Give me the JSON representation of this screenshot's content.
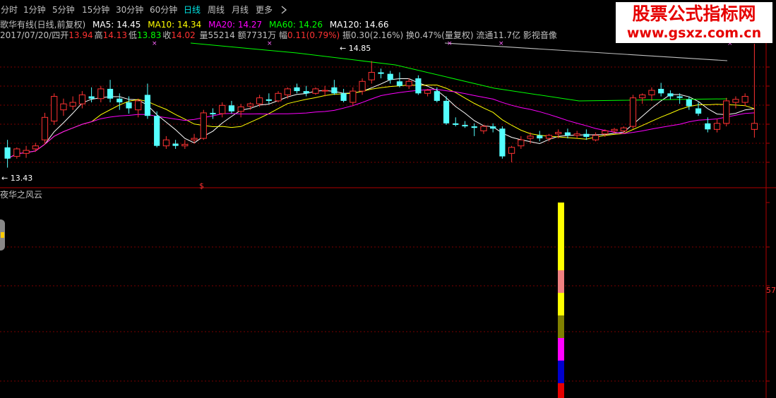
{
  "toolbar": {
    "tabs": [
      {
        "label": "分时",
        "active": false
      },
      {
        "label": "1分钟",
        "active": false
      },
      {
        "label": "5分钟",
        "active": false
      },
      {
        "label": "15分钟",
        "active": false
      },
      {
        "label": "30分钟",
        "active": false
      },
      {
        "label": "60分钟",
        "active": false
      },
      {
        "label": "日线",
        "active": true
      },
      {
        "label": "周线",
        "active": false
      },
      {
        "label": "月线",
        "active": false
      },
      {
        "label": "更多",
        "active": false
      }
    ],
    "more_icon": "chevron-right-icon"
  },
  "info_line1": {
    "stock_name": "歌华有线(日线,前复权)",
    "ma5": "MA5: 14.45",
    "ma10": "MA10: 14.34",
    "ma20": "MA20: 14.27",
    "ma60": "MA60: 14.26",
    "ma120": "MA120: 14.66"
  },
  "info_line2": {
    "date": "2017/07/20/四",
    "open_label": "开",
    "open": "13.94",
    "high_label": "高",
    "high": "14.13",
    "low_label": "低",
    "low": "13.83",
    "close_label": "收",
    "close": "14.02",
    "volume": "量55214",
    "amount": "额7731万",
    "change_label": "幅",
    "change": "0.11(0.79%)",
    "amplitude": "振0.30(2.16%)",
    "turnover": "换0.47%(量复权)",
    "float_shares": "流通11.7亿",
    "sector": "影视音像"
  },
  "price_annotations": {
    "high_label": "14.85",
    "low_label": "13.43",
    "dividend_mark": "$"
  },
  "watermark": {
    "title": "股票公式指标网",
    "url": "www.gsxz.com.cn"
  },
  "lower_panel": {
    "title": "夜华之风云",
    "right_scale_value": "57"
  },
  "colors": {
    "background": "#000000",
    "up_candle": "#ff3232",
    "down_candle": "#54ffff",
    "ma5": "#ffffff",
    "ma10": "#ffff00",
    "ma20": "#ff00ff",
    "ma60": "#00ff00",
    "ma120": "#ffffff",
    "grid": "#7a0000",
    "accent_tab": "#00e5e5",
    "watermark_red": "#e60000"
  },
  "chart_data": {
    "type": "candlestick",
    "ylim": [
      13.2,
      15.1
    ],
    "candles": [
      [
        13.7,
        13.8,
        13.43,
        13.55
      ],
      [
        13.58,
        13.7,
        13.55,
        13.68
      ],
      [
        13.62,
        13.72,
        13.56,
        13.66
      ],
      [
        13.68,
        13.76,
        13.64,
        13.72
      ],
      [
        13.8,
        14.16,
        13.74,
        14.1
      ],
      [
        14.05,
        14.42,
        14.0,
        14.38
      ],
      [
        14.2,
        14.35,
        14.12,
        14.28
      ],
      [
        14.25,
        14.38,
        14.2,
        14.3
      ],
      [
        14.28,
        14.45,
        14.22,
        14.4
      ],
      [
        14.38,
        14.5,
        14.3,
        14.35
      ],
      [
        14.35,
        14.52,
        14.3,
        14.48
      ],
      [
        14.48,
        14.6,
        14.3,
        14.35
      ],
      [
        14.35,
        14.42,
        14.2,
        14.3
      ],
      [
        14.3,
        14.38,
        14.15,
        14.22
      ],
      [
        14.2,
        14.35,
        14.1,
        14.32
      ],
      [
        14.4,
        14.55,
        14.08,
        14.12
      ],
      [
        14.12,
        14.18,
        13.7,
        13.72
      ],
      [
        13.72,
        13.85,
        13.68,
        13.8
      ],
      [
        13.75,
        13.8,
        13.68,
        13.72
      ],
      [
        13.72,
        13.8,
        13.68,
        13.74
      ],
      [
        13.8,
        13.88,
        13.75,
        13.82
      ],
      [
        13.82,
        14.2,
        13.8,
        14.16
      ],
      [
        14.16,
        14.22,
        14.08,
        14.14
      ],
      [
        14.15,
        14.3,
        14.1,
        14.26
      ],
      [
        14.26,
        14.32,
        14.15,
        14.18
      ],
      [
        14.18,
        14.28,
        14.1,
        14.24
      ],
      [
        14.25,
        14.3,
        14.2,
        14.28
      ],
      [
        14.28,
        14.4,
        14.24,
        14.36
      ],
      [
        14.34,
        14.42,
        14.28,
        14.32
      ],
      [
        14.32,
        14.45,
        14.3,
        14.42
      ],
      [
        14.4,
        14.5,
        14.35,
        14.48
      ],
      [
        14.5,
        14.55,
        14.42,
        14.45
      ],
      [
        14.45,
        14.52,
        14.38,
        14.42
      ],
      [
        14.42,
        14.5,
        14.4,
        14.48
      ],
      [
        14.45,
        14.52,
        14.38,
        14.46
      ],
      [
        14.5,
        14.6,
        14.4,
        14.42
      ],
      [
        14.42,
        14.48,
        14.3,
        14.32
      ],
      [
        14.3,
        14.5,
        14.25,
        14.45
      ],
      [
        14.45,
        14.62,
        14.4,
        14.58
      ],
      [
        14.6,
        14.85,
        14.55,
        14.7
      ],
      [
        14.7,
        14.75,
        14.62,
        14.68
      ],
      [
        14.68,
        14.72,
        14.55,
        14.6
      ],
      [
        14.58,
        14.7,
        14.5,
        14.52
      ],
      [
        14.52,
        14.62,
        14.48,
        14.58
      ],
      [
        14.62,
        14.66,
        14.4,
        14.42
      ],
      [
        14.42,
        14.48,
        14.38,
        14.46
      ],
      [
        14.45,
        14.5,
        14.3,
        14.32
      ],
      [
        14.32,
        14.38,
        14.0,
        14.02
      ],
      [
        14.02,
        14.1,
        13.98,
        14.0
      ],
      [
        14.0,
        14.05,
        13.96,
        13.98
      ],
      [
        13.98,
        14.02,
        13.85,
        13.96
      ],
      [
        13.92,
        14.0,
        13.88,
        13.98
      ],
      [
        13.98,
        14.02,
        13.9,
        13.95
      ],
      [
        13.95,
        13.98,
        13.55,
        13.58
      ],
      [
        13.62,
        13.72,
        13.5,
        13.7
      ],
      [
        13.72,
        13.85,
        13.68,
        13.8
      ],
      [
        13.82,
        13.9,
        13.75,
        13.85
      ],
      [
        13.86,
        13.92,
        13.78,
        13.82
      ],
      [
        13.82,
        13.88,
        13.78,
        13.86
      ],
      [
        13.88,
        13.94,
        13.82,
        13.9
      ],
      [
        13.9,
        13.95,
        13.82,
        13.86
      ],
      [
        13.86,
        13.92,
        13.82,
        13.88
      ],
      [
        13.88,
        13.94,
        13.8,
        13.84
      ],
      [
        13.8,
        13.9,
        13.78,
        13.86
      ],
      [
        13.88,
        13.94,
        13.84,
        13.92
      ],
      [
        13.92,
        13.96,
        13.88,
        13.94
      ],
      [
        13.92,
        13.98,
        13.88,
        13.96
      ],
      [
        13.98,
        14.4,
        13.95,
        14.36
      ],
      [
        14.36,
        14.42,
        14.28,
        14.4
      ],
      [
        14.4,
        14.5,
        14.32,
        14.46
      ],
      [
        14.48,
        14.56,
        14.38,
        14.42
      ],
      [
        14.42,
        14.46,
        14.34,
        14.38
      ],
      [
        14.38,
        14.42,
        14.28,
        14.36
      ],
      [
        14.34,
        14.38,
        14.2,
        14.25
      ],
      [
        14.22,
        14.3,
        14.12,
        14.15
      ],
      [
        14.02,
        14.1,
        13.9,
        13.94
      ],
      [
        13.94,
        14.08,
        13.9,
        14.02
      ],
      [
        14.02,
        14.36,
        13.98,
        14.32
      ],
      [
        14.3,
        14.38,
        14.22,
        14.34
      ],
      [
        14.3,
        14.42,
        14.25,
        14.38
      ],
      [
        13.94,
        14.13,
        13.83,
        14.02
      ]
    ]
  }
}
